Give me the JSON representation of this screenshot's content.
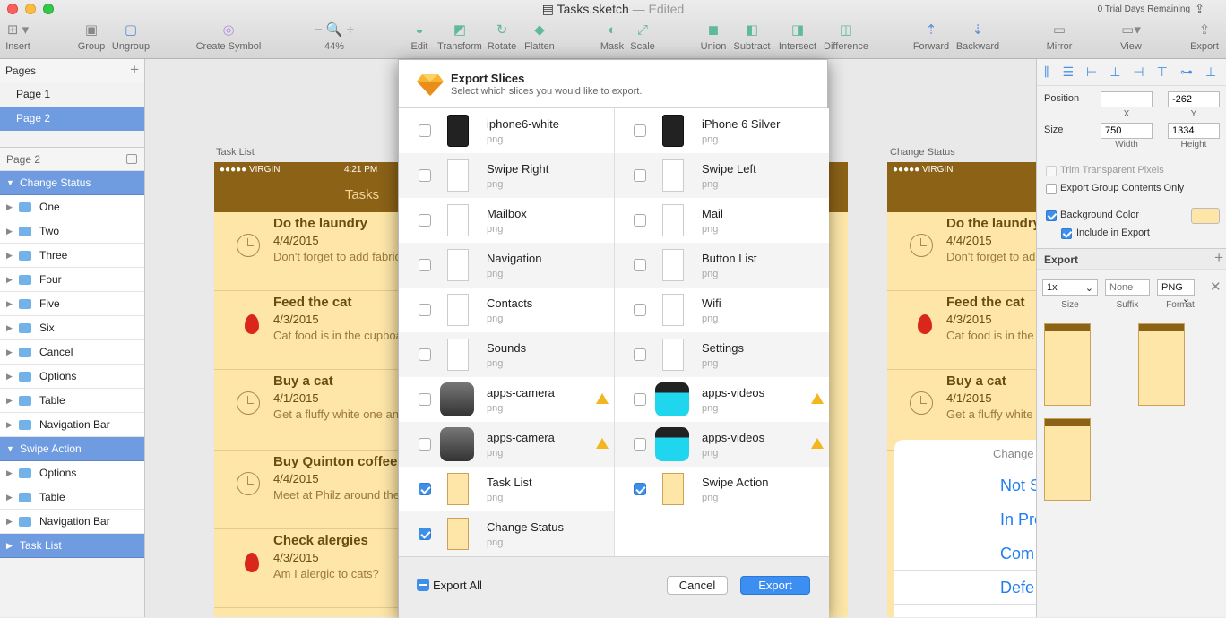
{
  "window": {
    "title": "Tasks.sketch",
    "edited": "— Edited",
    "trial": "0 Trial Days Remaining"
  },
  "toolbar": {
    "insert": "Insert",
    "group": "Group",
    "ungroup": "Ungroup",
    "create_symbol": "Create Symbol",
    "zoom": "44%",
    "edit": "Edit",
    "transform": "Transform",
    "rotate": "Rotate",
    "flatten": "Flatten",
    "mask": "Mask",
    "scale": "Scale",
    "union": "Union",
    "subtract": "Subtract",
    "intersect": "Intersect",
    "difference": "Difference",
    "forward": "Forward",
    "backward": "Backward",
    "mirror": "Mirror",
    "view": "View",
    "export": "Export"
  },
  "pages": {
    "header": "Pages",
    "items": [
      "Page 1",
      "Page 2"
    ]
  },
  "layers": {
    "header": "Page 2",
    "items": [
      {
        "label": "Change Status",
        "group": true
      },
      {
        "label": "One"
      },
      {
        "label": "Two"
      },
      {
        "label": "Three"
      },
      {
        "label": "Four"
      },
      {
        "label": "Five"
      },
      {
        "label": "Six"
      },
      {
        "label": "Cancel"
      },
      {
        "label": "Options"
      },
      {
        "label": "Table"
      },
      {
        "label": "Navigation Bar"
      },
      {
        "label": "Swipe Action",
        "group": true
      },
      {
        "label": "Options"
      },
      {
        "label": "Table"
      },
      {
        "label": "Navigation Bar"
      },
      {
        "label": "Task List",
        "group": true
      }
    ]
  },
  "canvas": {
    "label_task_list": "Task List",
    "label_change_status": "Change Status",
    "carrier": "●●●●● VIRGIN",
    "time": "4:21 PM",
    "nav_title": "Tasks",
    "tasks": [
      {
        "title": "Do the laundry",
        "date": "4/4/2015",
        "note": "Don't forget to add fabric"
      },
      {
        "title": "Feed the cat",
        "date": "4/3/2015",
        "note": "Cat food is in the cupboard"
      },
      {
        "title": "Buy a cat",
        "date": "4/1/2015",
        "note": "Get a fluffy white one and"
      },
      {
        "title": "Buy Quinton coffee",
        "date": "4/4/2015",
        "note": "Meet at Philz around the"
      },
      {
        "title": "Check alergies",
        "date": "4/3/2015",
        "note": "Am I alergic to cats?"
      }
    ],
    "right_sheet": [
      "Change",
      "Not S",
      "In Pro",
      "Com",
      "Defe"
    ]
  },
  "dialog": {
    "title": "Export Slices",
    "subtitle": "Select which slices you would like to export.",
    "slices": [
      {
        "name": "iphone6-white",
        "ext": "png",
        "checked": false,
        "thumb": "phone6"
      },
      {
        "name": "iPhone 6 Silver",
        "ext": "png",
        "checked": false,
        "thumb": "phone6"
      },
      {
        "name": "Swipe Right",
        "ext": "png",
        "checked": false,
        "thumb": "doc"
      },
      {
        "name": "Swipe Left",
        "ext": "png",
        "checked": false,
        "thumb": "doc"
      },
      {
        "name": "Mailbox",
        "ext": "png",
        "checked": false,
        "thumb": "doc"
      },
      {
        "name": "Mail",
        "ext": "png",
        "checked": false,
        "thumb": "doc"
      },
      {
        "name": "Navigation",
        "ext": "png",
        "checked": false,
        "thumb": "doc"
      },
      {
        "name": "Button List",
        "ext": "png",
        "checked": false,
        "thumb": "doc"
      },
      {
        "name": "Contacts",
        "ext": "png",
        "checked": false,
        "thumb": "doc"
      },
      {
        "name": "Wifi",
        "ext": "png",
        "checked": false,
        "thumb": "doc"
      },
      {
        "name": "Sounds",
        "ext": "png",
        "checked": false,
        "thumb": "doc"
      },
      {
        "name": "Settings",
        "ext": "png",
        "checked": false,
        "thumb": "doc"
      },
      {
        "name": "apps-camera",
        "ext": "png",
        "checked": false,
        "thumb": "cam",
        "warn": true
      },
      {
        "name": "apps-videos",
        "ext": "png",
        "checked": false,
        "thumb": "vid",
        "warn": true
      },
      {
        "name": "apps-camera",
        "ext": "png",
        "checked": false,
        "thumb": "cam",
        "warn": true
      },
      {
        "name": "apps-videos",
        "ext": "png",
        "checked": false,
        "thumb": "vid",
        "warn": true
      },
      {
        "name": "Task List",
        "ext": "png",
        "checked": true,
        "thumb": "yel"
      },
      {
        "name": "Swipe Action",
        "ext": "png",
        "checked": true,
        "thumb": "yel"
      },
      {
        "name": "Change Status",
        "ext": "png",
        "checked": true,
        "thumb": "yel"
      }
    ],
    "export_all": "Export All",
    "cancel": "Cancel",
    "export": "Export"
  },
  "inspector": {
    "position": "Position",
    "x_value": "",
    "y_value": "-262",
    "x_label": "X",
    "y_label": "Y",
    "size": "Size",
    "width_value": "750",
    "height_value": "1334",
    "width_label": "Width",
    "height_label": "Height",
    "trim": "Trim Transparent Pixels",
    "export_group": "Export Group Contents Only",
    "bg_color": "Background Color",
    "include_export": "Include in Export",
    "export_header": "Export",
    "scale_value": "1x",
    "suffix_placeholder": "None",
    "format_value": "PNG",
    "size_label": "Size",
    "suffix_label": "Suffix",
    "format_label": "Format",
    "bg_hex": "#fde6a8"
  }
}
